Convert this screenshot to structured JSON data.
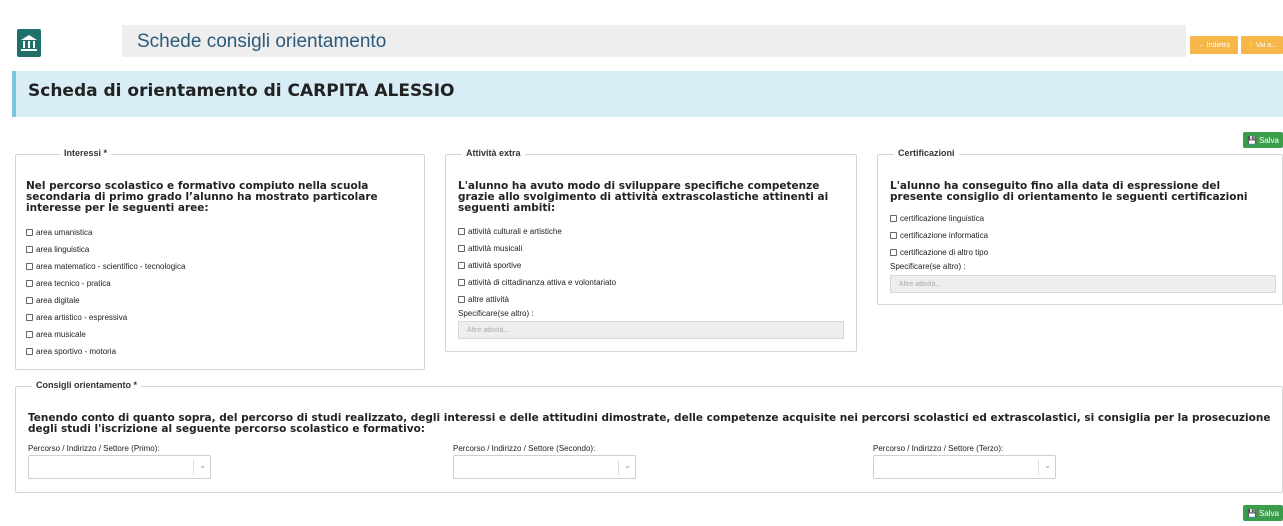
{
  "header": {
    "title": "Schede consigli orientamento",
    "back_label": "Indietro",
    "goto_label": "Vai a..."
  },
  "student_title": "Scheda di orientamento di CARPITA ALESSIO",
  "save_label": "Salva",
  "interessi": {
    "legend": "Interessi *",
    "intro": "Nel percorso scolastico e formativo compiuto nella scuola secondaria di primo grado l’alunno ha mostrato particolare interesse per le seguenti aree:",
    "options": [
      "area umanistica",
      "area linguistica",
      "area matematico - scientifico - tecnologica",
      "area tecnico - pratica",
      "area digitale",
      "area artistico - espressiva",
      "area musicale",
      "area sportivo - motoria"
    ]
  },
  "attivita": {
    "legend": "Attività extra",
    "intro": "L'alunno ha avuto modo di sviluppare specifiche competenze grazie allo svolgimento di attività extrascolastiche attinenti ai seguenti ambiti:",
    "options": [
      "attività culturali e artistiche",
      "attività musicali",
      "attività sportive",
      "attività di cittadinanza attiva e volontariato",
      "altre attività"
    ],
    "specify_label": "Specificare(se altro) :",
    "specify_placeholder": "Altre attività..."
  },
  "certificazioni": {
    "legend": "Certificazioni",
    "intro": "L'alunno ha conseguito fino alla data di espressione del presente consiglio di orientamento le seguenti certificazioni",
    "options": [
      "certificazione linguistica",
      "certificazione informatica",
      "certificazione di altro tipo"
    ],
    "specify_label": "Specificare(se altro) :",
    "specify_placeholder": "Altre attività..."
  },
  "consigli": {
    "legend": "Consigli orientamento *",
    "intro": "Tenendo conto di quanto sopra, del percorso di studi realizzato, degli interessi e delle attitudini dimostrate, delle competenze acquisite nei percorsi scolastici ed extrascolastici, si consiglia per la prosecuzione degli studi l'iscrizione al seguente percorso scolastico e formativo:",
    "selects": [
      "Percorso / Indirizzo / Settore (Primo):",
      "Percorso / Indirizzo / Settore (Secondo):",
      "Percorso / Indirizzo / Settore (Terzo):"
    ]
  },
  "colors": {
    "accent_orange": "#f6b64a",
    "save_green": "#3a9d4a",
    "heading_bg": "#d9edf7",
    "title_blue": "#2b5a7a"
  }
}
